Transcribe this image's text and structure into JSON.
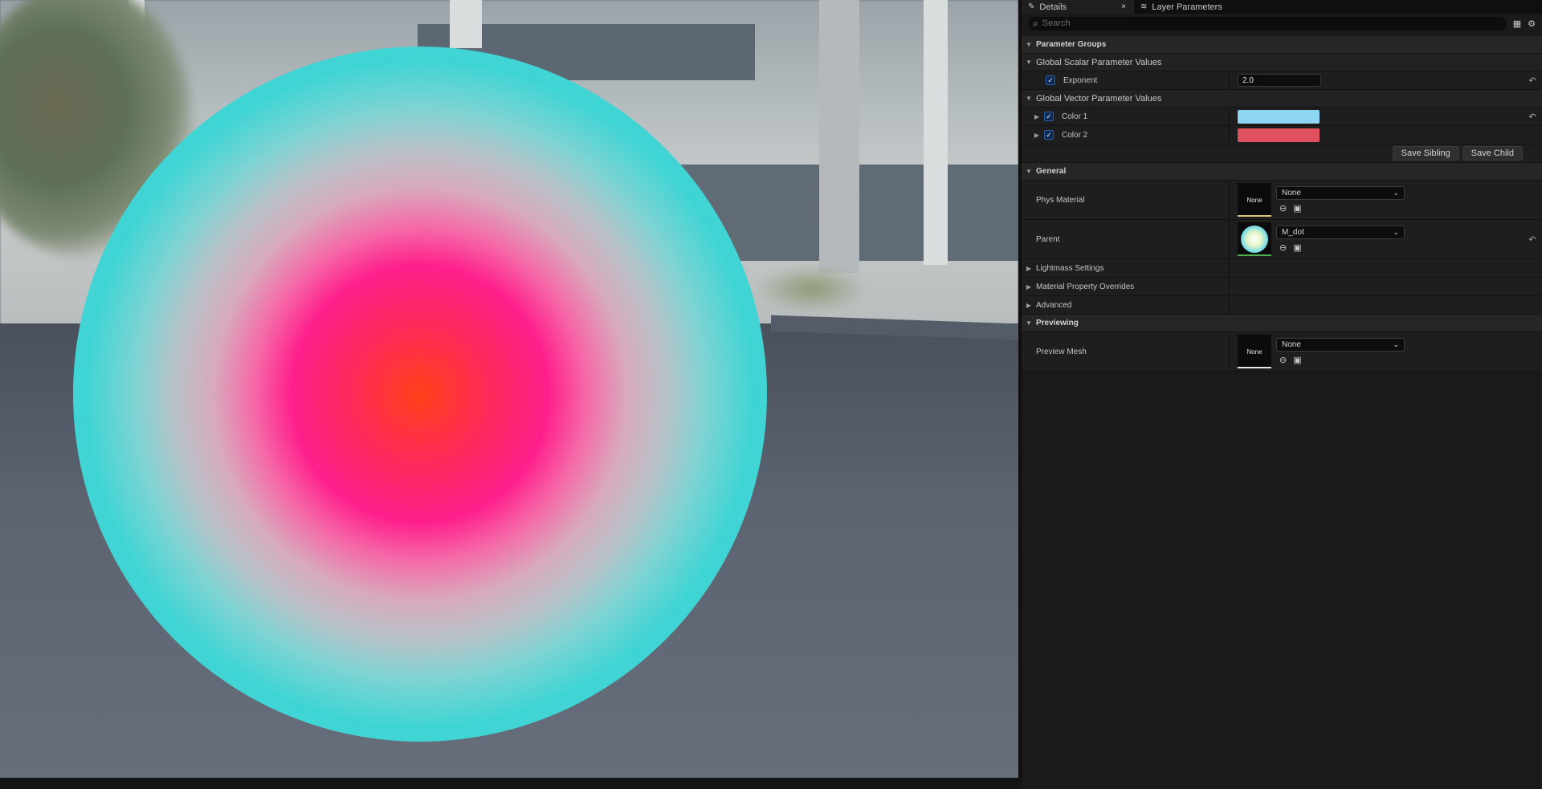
{
  "tabs": {
    "details": "Details",
    "details_close": "×",
    "layer_parameters": "Layer Parameters"
  },
  "search": {
    "placeholder": "Search"
  },
  "sections": {
    "parameter_groups": "Parameter Groups",
    "general": "General",
    "lightmass": "Lightmass Settings",
    "material_overrides": "Material Property Overrides",
    "advanced": "Advanced",
    "previewing": "Previewing"
  },
  "scalar": {
    "header": "Global Scalar Parameter Values",
    "exponent_label": "Exponent",
    "exponent_value": "2.0"
  },
  "vector": {
    "header": "Global Vector Parameter Values",
    "color1_label": "Color 1",
    "color1_swatch": "#8fd6f5",
    "color2_label": "Color 2",
    "color2_swatch": "#e0505f"
  },
  "buttons": {
    "save_sibling": "Save Sibling",
    "save_child": "Save Child"
  },
  "general": {
    "phys_material_label": "Phys Material",
    "phys_material_thumb": "None",
    "phys_material_value": "None",
    "parent_label": "Parent",
    "parent_value": "M_dot"
  },
  "previewing": {
    "preview_mesh_label": "Preview Mesh",
    "preview_mesh_thumb": "None",
    "preview_mesh_value": "None"
  }
}
